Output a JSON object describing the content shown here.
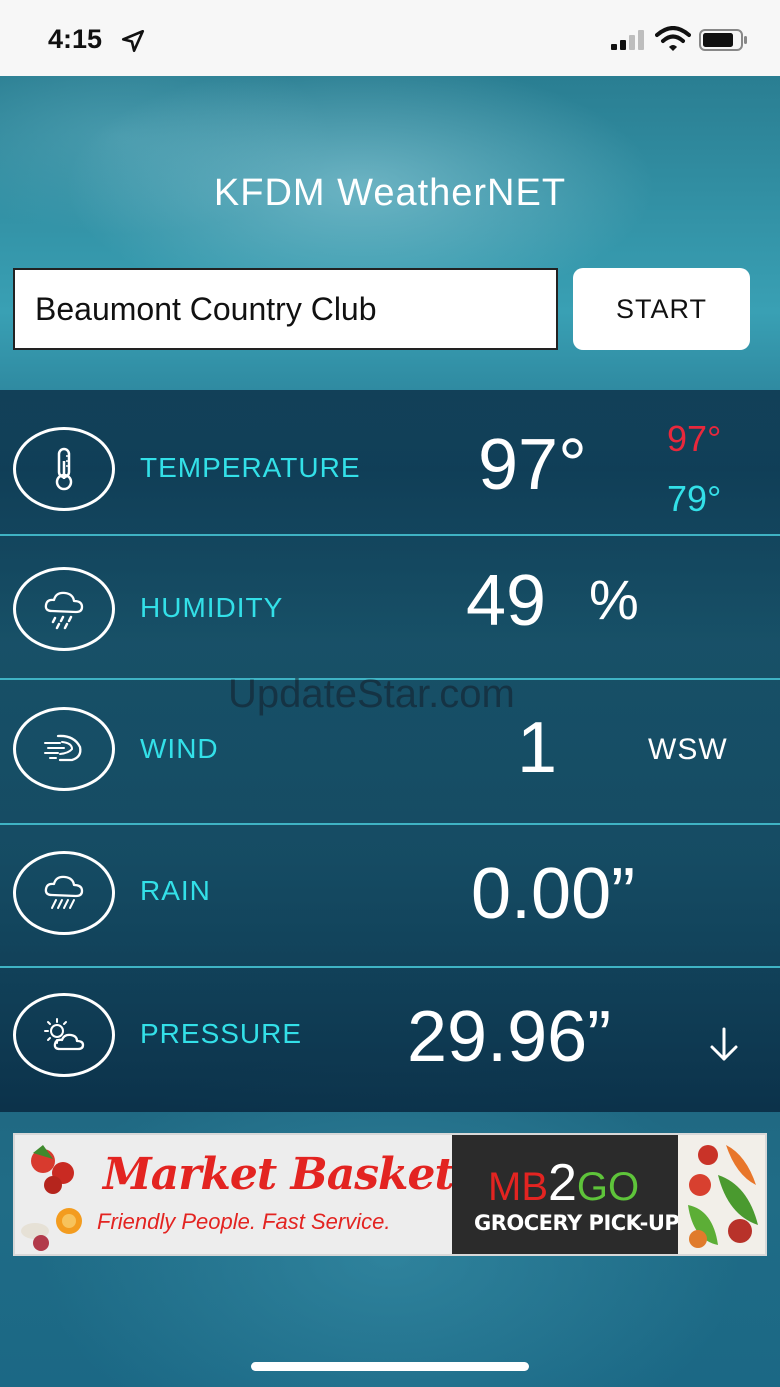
{
  "status_bar": {
    "time": "4:15"
  },
  "app": {
    "title": "KFDM WeatherNET"
  },
  "location": {
    "value": "Beaumont Country Club",
    "start_label": "START"
  },
  "readings": {
    "temperature": {
      "label": "TEMPERATURE",
      "value": "97°",
      "high": "97°",
      "low": "79°"
    },
    "humidity": {
      "label": "HUMIDITY",
      "value": "49",
      "unit": "%"
    },
    "wind": {
      "label": "WIND",
      "value": "1",
      "direction": "WSW"
    },
    "rain": {
      "label": "RAIN",
      "value": "0.00”"
    },
    "pressure": {
      "label": "PRESSURE",
      "value": "29.96”",
      "trend": "falling"
    }
  },
  "watermark": "UpdateStar.com",
  "ad": {
    "brand": "Market Basket",
    "tagline": "Friendly People. Fast Service.",
    "mb": "MB",
    "two": "2",
    "go": "GO",
    "pickup": "GROCERY PICK-UP"
  },
  "colors": {
    "accent_cyan": "#33e0e8",
    "high_red": "#e8283c",
    "divider": "#3fb3c4"
  }
}
